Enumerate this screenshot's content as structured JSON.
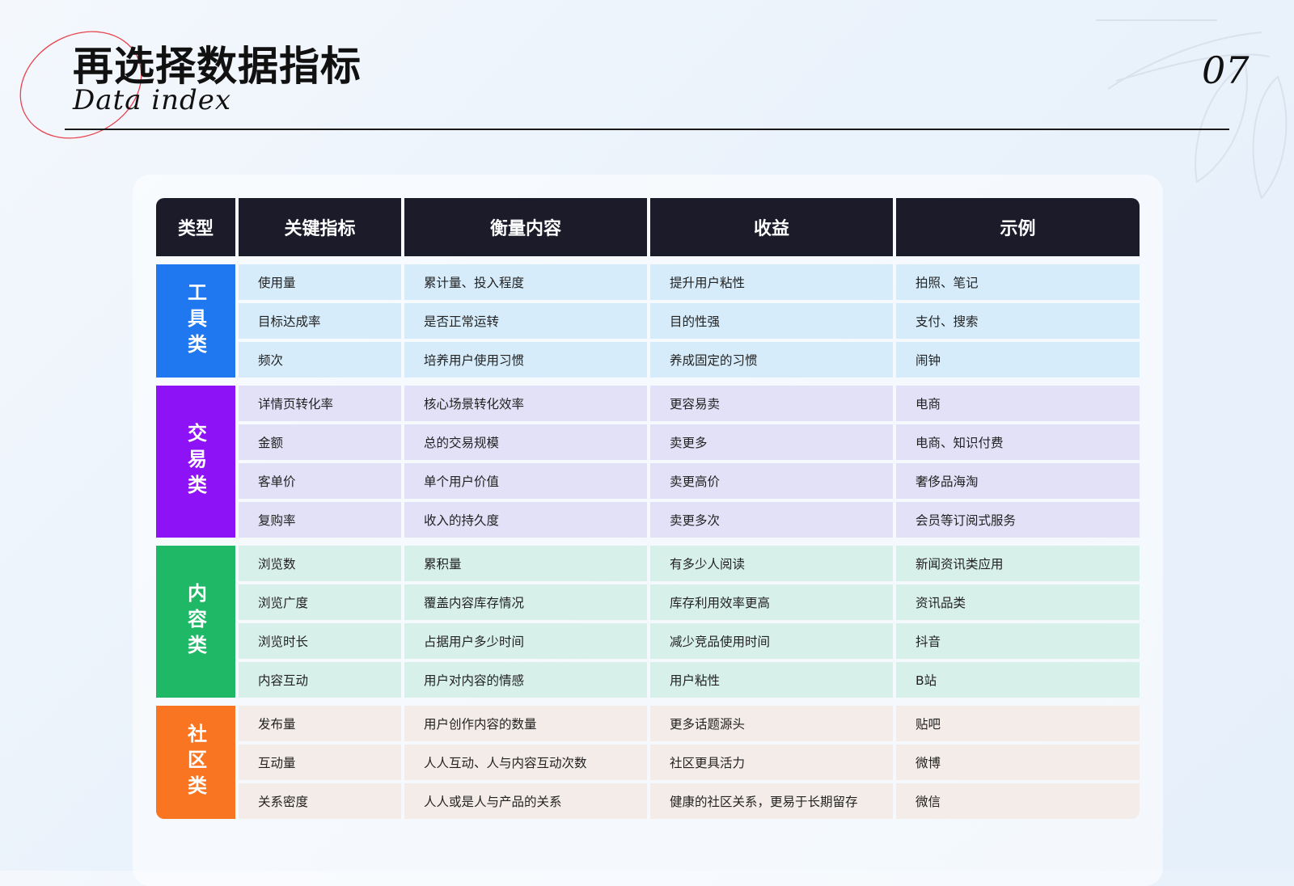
{
  "header": {
    "title": "再选择数据指标",
    "subtitle": "Data index",
    "page_number": "07"
  },
  "colors": {
    "header_bg": "#1b1b2a",
    "tool": "#1f78f0",
    "trade": "#8d12f5",
    "content": "#1fb866",
    "community": "#f97522",
    "tool_row": "#d6ecfb",
    "trade_row": "#e2e1f8",
    "content_row": "#d8f0ea",
    "community_row": "#f4ece8",
    "accent_circle": "#e8434f"
  },
  "table": {
    "columns": [
      "类型",
      "关键指标",
      "衡量内容",
      "收益",
      "示例"
    ],
    "groups": [
      {
        "category": "工具类",
        "color": "#1f78f0",
        "row_color": "#d6ecfb",
        "rows": [
          [
            "使用量",
            "累计量、投入程度",
            "提升用户粘性",
            "拍照、笔记"
          ],
          [
            "目标达成率",
            "是否正常运转",
            "目的性强",
            "支付、搜索"
          ],
          [
            "频次",
            "培养用户使用习惯",
            "养成固定的习惯",
            "闹钟"
          ]
        ]
      },
      {
        "category": "交易类",
        "color": "#8d12f5",
        "row_color": "#e2e1f8",
        "rows": [
          [
            "详情页转化率",
            "核心场景转化效率",
            "更容易卖",
            "电商"
          ],
          [
            "金额",
            "总的交易规模",
            "卖更多",
            "电商、知识付费"
          ],
          [
            "客单价",
            "单个用户价值",
            "卖更高价",
            "奢侈品海淘"
          ],
          [
            "复购率",
            "收入的持久度",
            "卖更多次",
            "会员等订阅式服务"
          ]
        ]
      },
      {
        "category": "内容类",
        "color": "#1fb866",
        "row_color": "#d8f0ea",
        "rows": [
          [
            "浏览数",
            "累积量",
            "有多少人阅读",
            "新闻资讯类应用"
          ],
          [
            "浏览广度",
            "覆盖内容库存情况",
            "库存利用效率更高",
            "资讯品类"
          ],
          [
            "浏览时长",
            "占据用户多少时间",
            "减少竞品使用时间",
            "抖音"
          ],
          [
            "内容互动",
            "用户对内容的情感",
            "用户粘性",
            "B站"
          ]
        ]
      },
      {
        "category": "社区类",
        "color": "#f97522",
        "row_color": "#f4ece8",
        "rows": [
          [
            "发布量",
            "用户创作内容的数量",
            "更多话题源头",
            "贴吧"
          ],
          [
            "互动量",
            "人人互动、人与内容互动次数",
            "社区更具活力",
            "微博"
          ],
          [
            "关系密度",
            "人人或是人与产品的关系",
            "健康的社区关系，更易于长期留存",
            "微信"
          ]
        ]
      }
    ]
  }
}
